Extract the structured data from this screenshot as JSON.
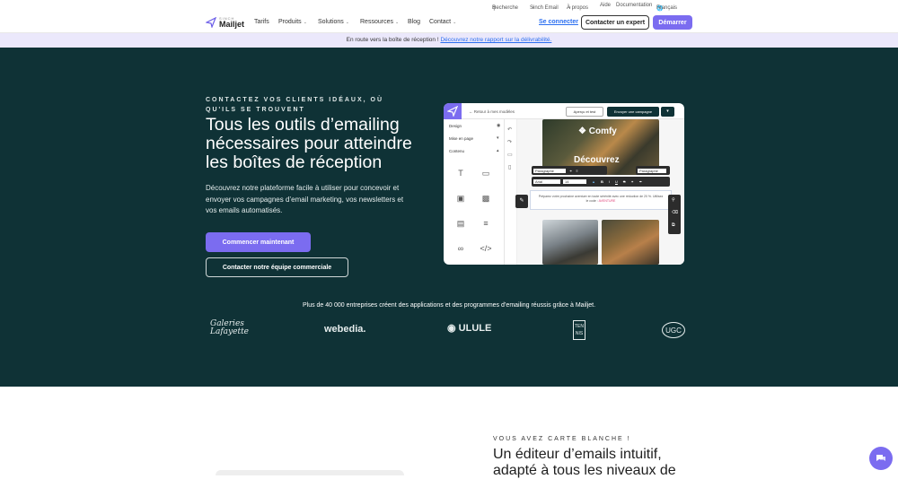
{
  "util": {
    "search": "Recherche",
    "sinch_email": "Sinch Email",
    "about": "À propos",
    "help": "Aide",
    "docs": "Documentation",
    "language": "Français"
  },
  "nav": {
    "brand_small": "SINCH",
    "brand": "Mailjet",
    "items": [
      "Tarifs",
      "Produits",
      "Solutions",
      "Ressources",
      "Blog",
      "Contact"
    ],
    "login": "Se connecter",
    "contact_expert": "Contacter un expert",
    "start": "Démarrer"
  },
  "banner": {
    "text": "En route vers la boîte de réception ! ",
    "link": "Découvrez notre rapport sur la délivrabilité."
  },
  "hero": {
    "eyebrow": "CONTACTEZ VOS CLIENTS IDÉAUX, OÙ QU'ILS SE TROUVENT",
    "title": "Tous les outils d’emailing nécessaires pour atteindre les boîtes de réception",
    "description": "Découvrez notre plateforme facile à utiliser pour concevoir et envoyer vos campagnes d’email marketing, vos newsletters et vos emails automatisés.",
    "cta_primary": "Commencer maintenant",
    "cta_secondary": "Contacter notre équipe commerciale",
    "social_proof": "Plus de 40 000 entreprises créent des applications et des programmes d’emailing réussis grâce à Mailjet.",
    "logos": [
      "Galeries Lafayette",
      "webedia.",
      "ULULE",
      "TEN NIS",
      "UGC"
    ]
  },
  "editor": {
    "back": "Retour à mes modèles",
    "preview": "Aperçu et test",
    "send": "Envoyer une campagne",
    "panel_items": [
      "Design",
      "Mise en page",
      "Contenu"
    ],
    "brand": "Comfy",
    "headline": "Découvrez",
    "font_style": "Paragraphe",
    "font_name": "Arial",
    "font_size": "14",
    "body_text": "Préparez votre prochaine aventure en toute sérénité avec une réduction de 20 %. Utilisez le code : ",
    "promo_code": "AVENTURE",
    "style_label": "Paragraphe"
  },
  "lower": {
    "eyebrow": "VOUS AVEZ CARTE BLANCHE !",
    "title": "Un éditeur d’emails intuitif, adapté à tous les niveaux de"
  },
  "colors": {
    "accent": "#7b6cf0",
    "hero_bg": "#0f3236",
    "banner_bg": "#ebe8fb",
    "link": "#2a6ef0"
  }
}
